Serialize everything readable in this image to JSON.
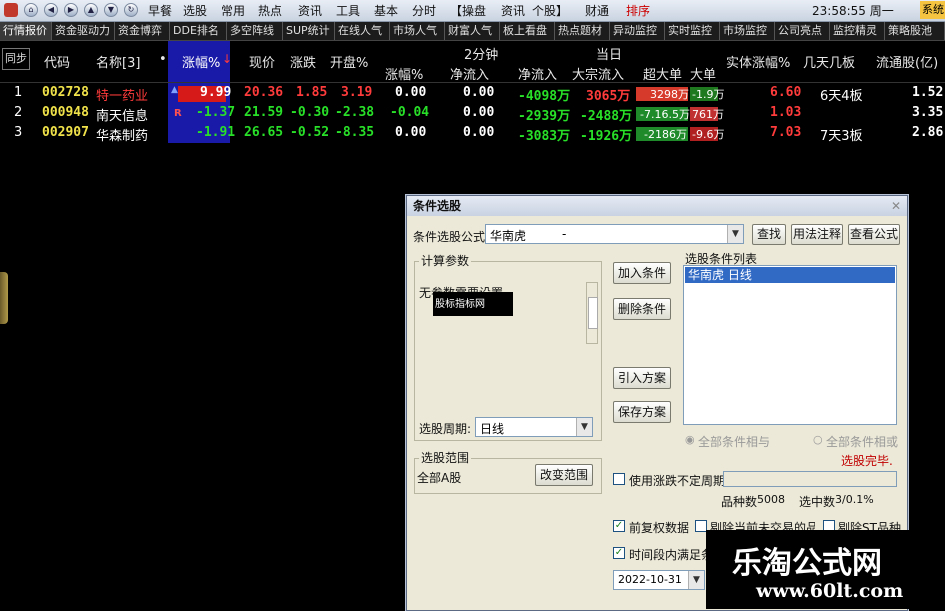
{
  "menu": {
    "items": [
      "早餐",
      "选股",
      "常用",
      "热点",
      "资讯",
      "工具",
      "基本",
      "分时",
      "【操盘",
      "资讯",
      "个股】",
      "财通",
      "排序"
    ],
    "clock": "23:58:55 周一",
    "sys_label": "系统"
  },
  "tabs": [
    "行情报价",
    "资金驱动力",
    "资金博弈",
    "DDE排名",
    "多空阵线",
    "SUP统计",
    "在线人气",
    "市场人气",
    "财富人气",
    "板上看盘",
    "热点题材",
    "异动监控",
    "实时监控",
    "市场监控",
    "公司亮点",
    "监控精灵",
    "策略股池"
  ],
  "table": {
    "sync_label": "同步",
    "group_headers": {
      "two_min": "2分钟",
      "today": "当日"
    },
    "headers": {
      "code": "代码",
      "name": "名称[3]",
      "dot": "•",
      "pct": "涨幅%",
      "price": "现价",
      "change": "涨跌",
      "open_pct": "开盘%",
      "pct2": "涨幅%",
      "net_in2": "净流入",
      "net_in": "净流入",
      "block_in": "大宗流入",
      "super_big": "超大单",
      "big": "大单",
      "body_pct": "实体涨幅%",
      "days_boards": "几天几板",
      "float_shares": "流通股(亿)"
    },
    "rows": [
      {
        "idx": "1",
        "code": "002728",
        "name": "特一药业",
        "flag": "",
        "pct": "9.99",
        "price": "20.36",
        "change": "1.85",
        "open_pct": "3.19",
        "pct2": "0.00",
        "net_in2": "0.00",
        "net_in": "-4098万",
        "block_in": "3065万",
        "super_big": "3298万",
        "big": "-1.9万",
        "body_pct": "6.60",
        "days_boards": "6天4板",
        "float_shares": "1.52"
      },
      {
        "idx": "2",
        "code": "000948",
        "name": "南天信息",
        "flag": "R",
        "pct": "-1.37",
        "price": "21.59",
        "change": "-0.30",
        "open_pct": "-2.38",
        "pct2": "-0.04",
        "net_in2": "0.00",
        "net_in": "-2939万",
        "block_in": "-2488万",
        "super_big": "-7.16.5万",
        "big": "761万",
        "body_pct": "1.03",
        "days_boards": "",
        "float_shares": "3.35"
      },
      {
        "idx": "3",
        "code": "002907",
        "name": "华森制药",
        "flag": "",
        "pct": "-1.91",
        "price": "26.65",
        "change": "-0.52",
        "open_pct": "-8.35",
        "pct2": "0.00",
        "net_in2": "0.00",
        "net_in": "-3083万",
        "block_in": "-1926万",
        "super_big": "-2186万",
        "big": "-9.6万",
        "body_pct": "7.03",
        "days_boards": "7天3板",
        "float_shares": "2.86"
      }
    ]
  },
  "dialog": {
    "title": "条件选股",
    "formula_label": "条件选股公式",
    "formula_value": "华南虎",
    "formula_value_suffix": "-",
    "find_btn": "查找",
    "usage_btn": "用法注释",
    "view_btn": "查看公式",
    "params_group": "计算参数",
    "params_text": "无参数需要设置",
    "tooltip": "股标指标网",
    "period_label": "选股周期:",
    "period_value": "日线",
    "range_group": "选股范围",
    "range_value": "全部A股",
    "change_range_btn": "改变范围",
    "add_cond_btn": "加入条件",
    "del_cond_btn": "删除条件",
    "import_btn": "引入方案",
    "save_btn": "保存方案",
    "cond_list_label": "选股条件列表",
    "cond_list_item": "华南虎   日线",
    "radio_and": "全部条件相与",
    "radio_or": "全部条件相或",
    "status": "选股完毕.",
    "chk_indef": "使用涨跌不定周期",
    "count_label": "品种数",
    "count_value": "5008",
    "selected_label": "选中数",
    "selected_value": "3/0.1%",
    "chk_pre_adj": "前复权数据",
    "chk_exclude_suspended": "剔除当前未交易的品种",
    "chk_exclude_st": "剔除ST品种",
    "chk_period": "时间段内满足条件",
    "date_value": "2022-10-31"
  },
  "watermark": {
    "title": "乐淘公式网",
    "url": "www.60lt.com"
  },
  "colors": {
    "up": "#ff3b3b",
    "down": "#28e028",
    "code": "#f0e24a",
    "highlight_col": "#1a1aa8"
  }
}
